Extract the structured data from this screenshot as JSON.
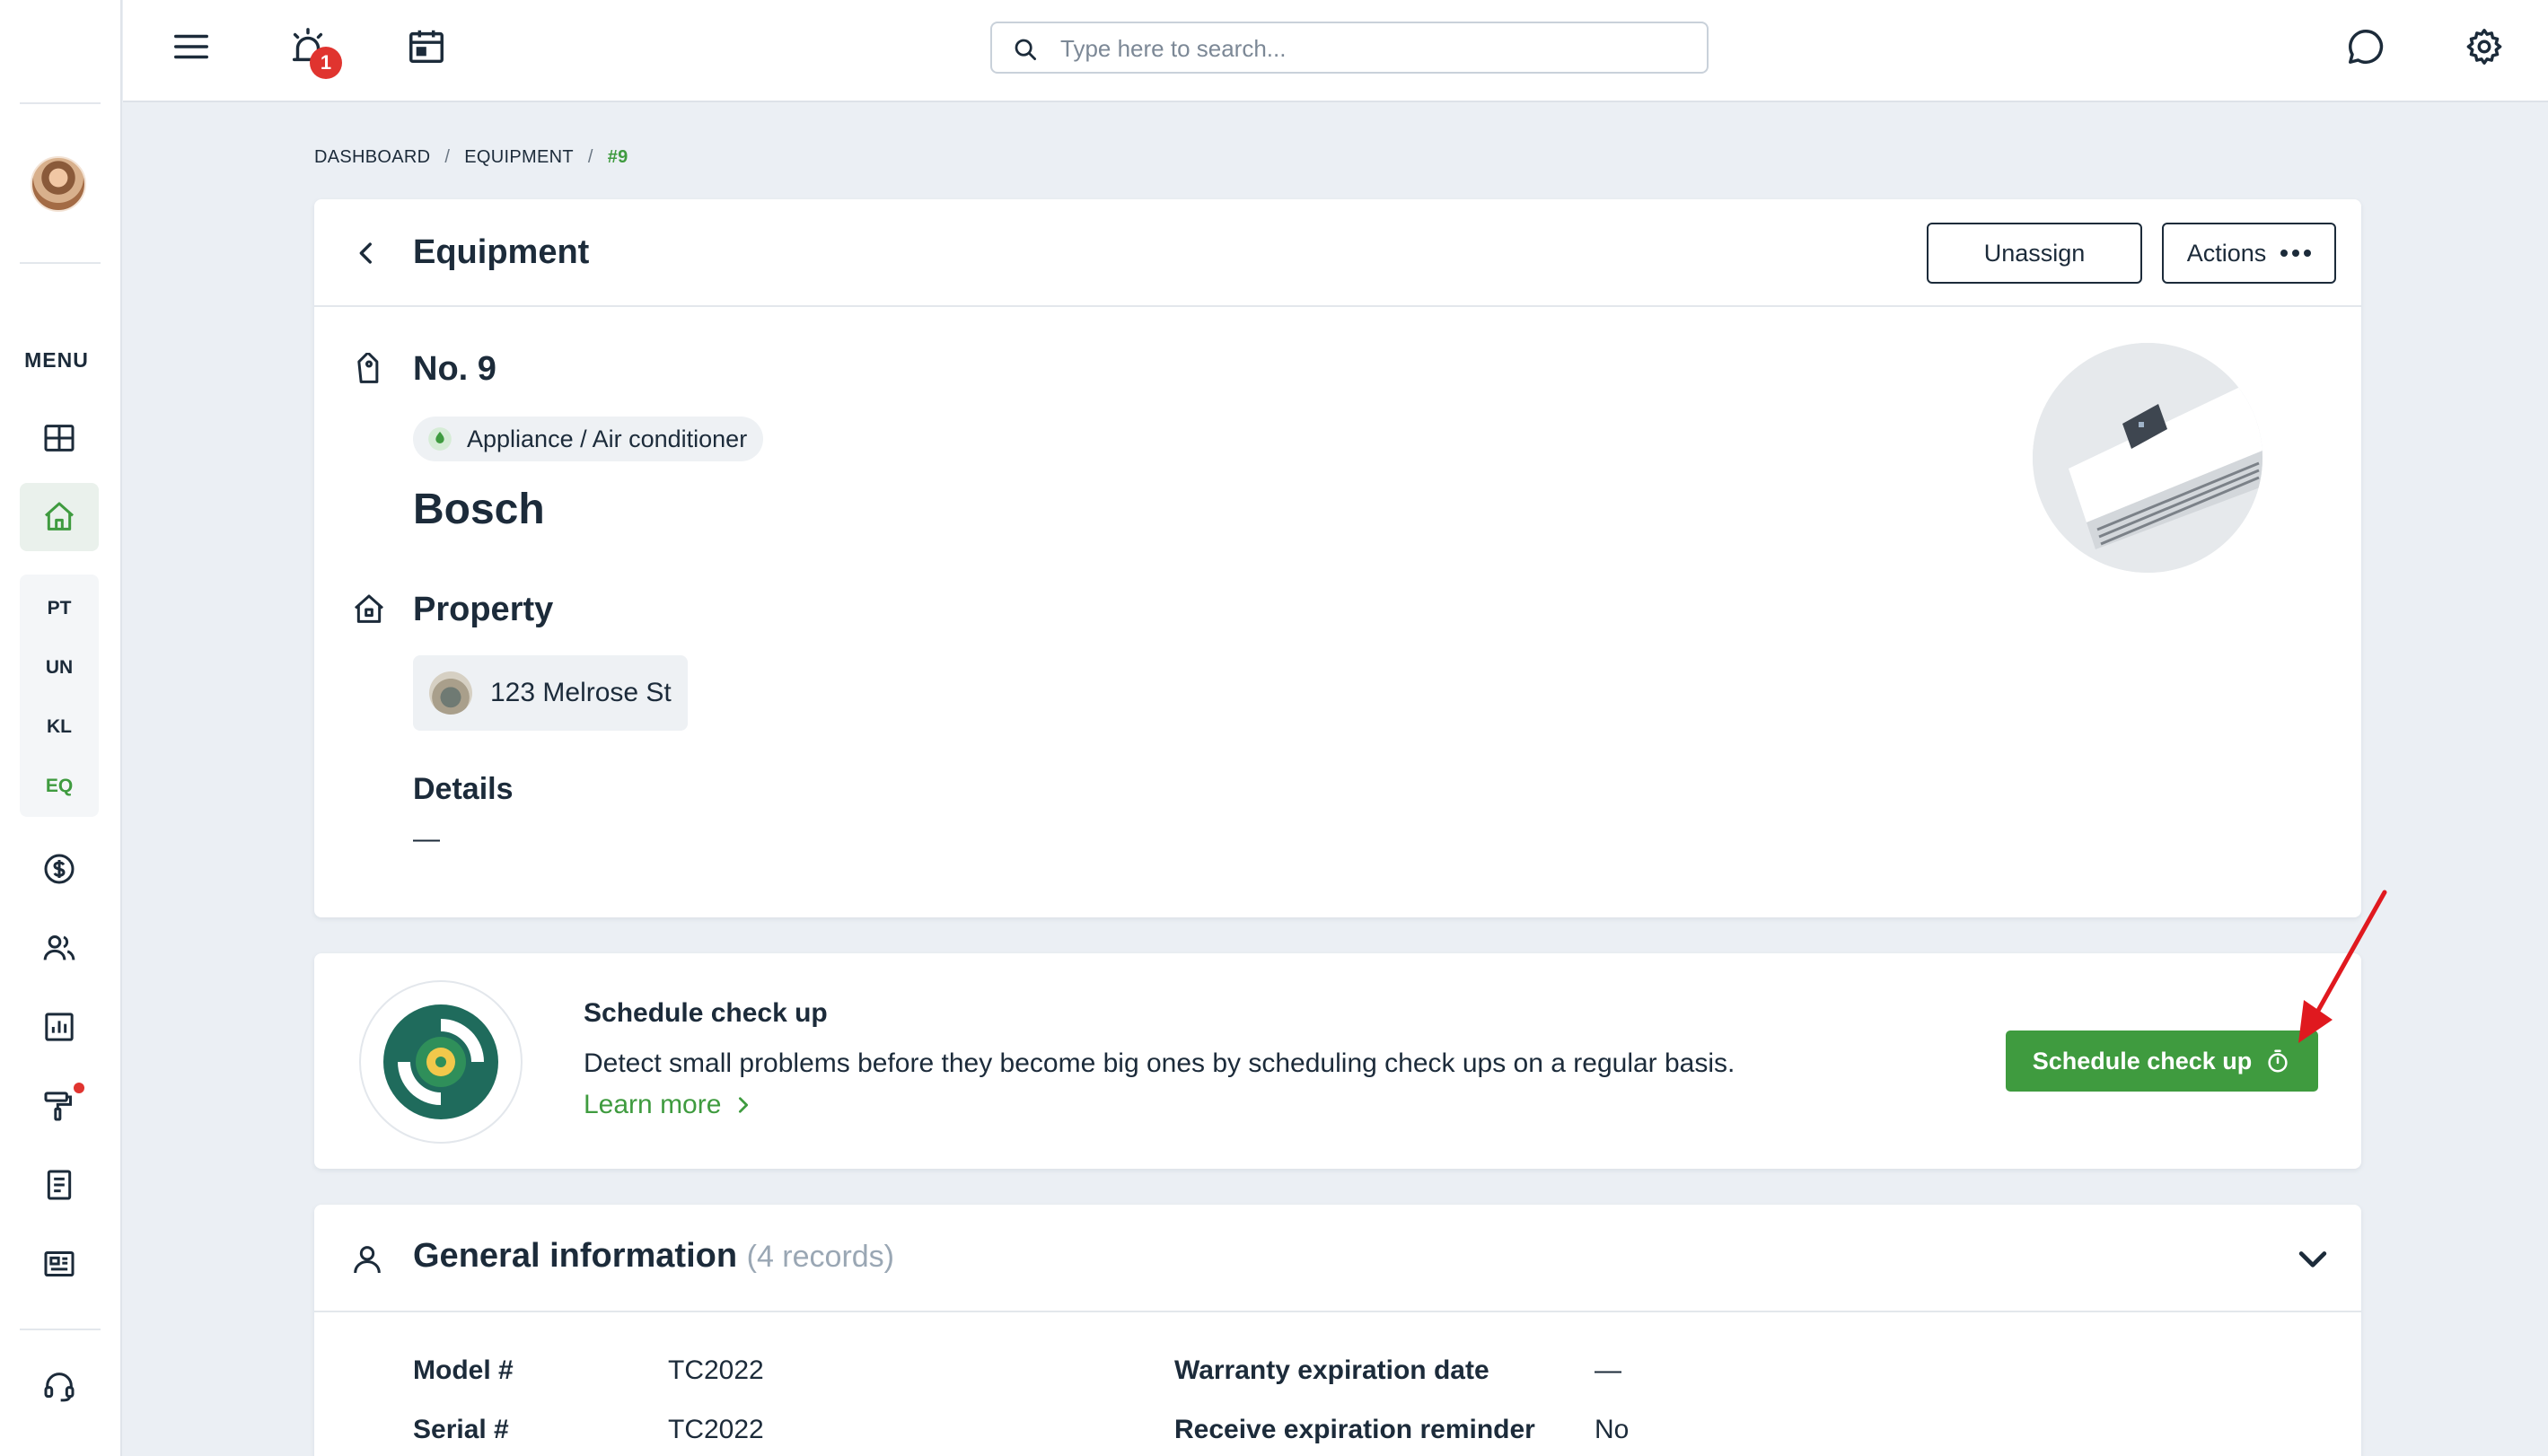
{
  "sidebar": {
    "menu_label": "MENU",
    "sub_items": [
      "PT",
      "UN",
      "KL",
      "EQ"
    ],
    "active_sub_item": "EQ"
  },
  "topbar": {
    "notification_count": "1",
    "search": {
      "placeholder": "Type here to search..."
    }
  },
  "breadcrumb": [
    "DASHBOARD",
    "EQUIPMENT",
    "#9"
  ],
  "equipment": {
    "header_title": "Equipment",
    "unassign_label": "Unassign",
    "actions_label": "Actions",
    "number": "No. 9",
    "category": "Appliance / Air conditioner",
    "brand": "Bosch",
    "property_title": "Property",
    "property_address": "123 Melrose St",
    "details_title": "Details",
    "details_value": "—"
  },
  "schedule": {
    "title": "Schedule check up",
    "description": "Detect small problems before they become big ones by scheduling check ups on a regular basis.",
    "learn_more": "Learn more",
    "button_label": "Schedule check up"
  },
  "general_info": {
    "title": "General information",
    "count": "(4 records)",
    "fields": [
      {
        "label": "Model #",
        "value": "TC2022"
      },
      {
        "label": "Serial #",
        "value": "TC2022"
      },
      {
        "label": "Warranty expiration date",
        "value": "—"
      },
      {
        "label": "Receive expiration reminder",
        "value": "No"
      }
    ]
  },
  "colors": {
    "accent": "#3f9b3f",
    "background": "#ebeff4",
    "text": "#1c2b3a",
    "badge": "#e0342f"
  }
}
